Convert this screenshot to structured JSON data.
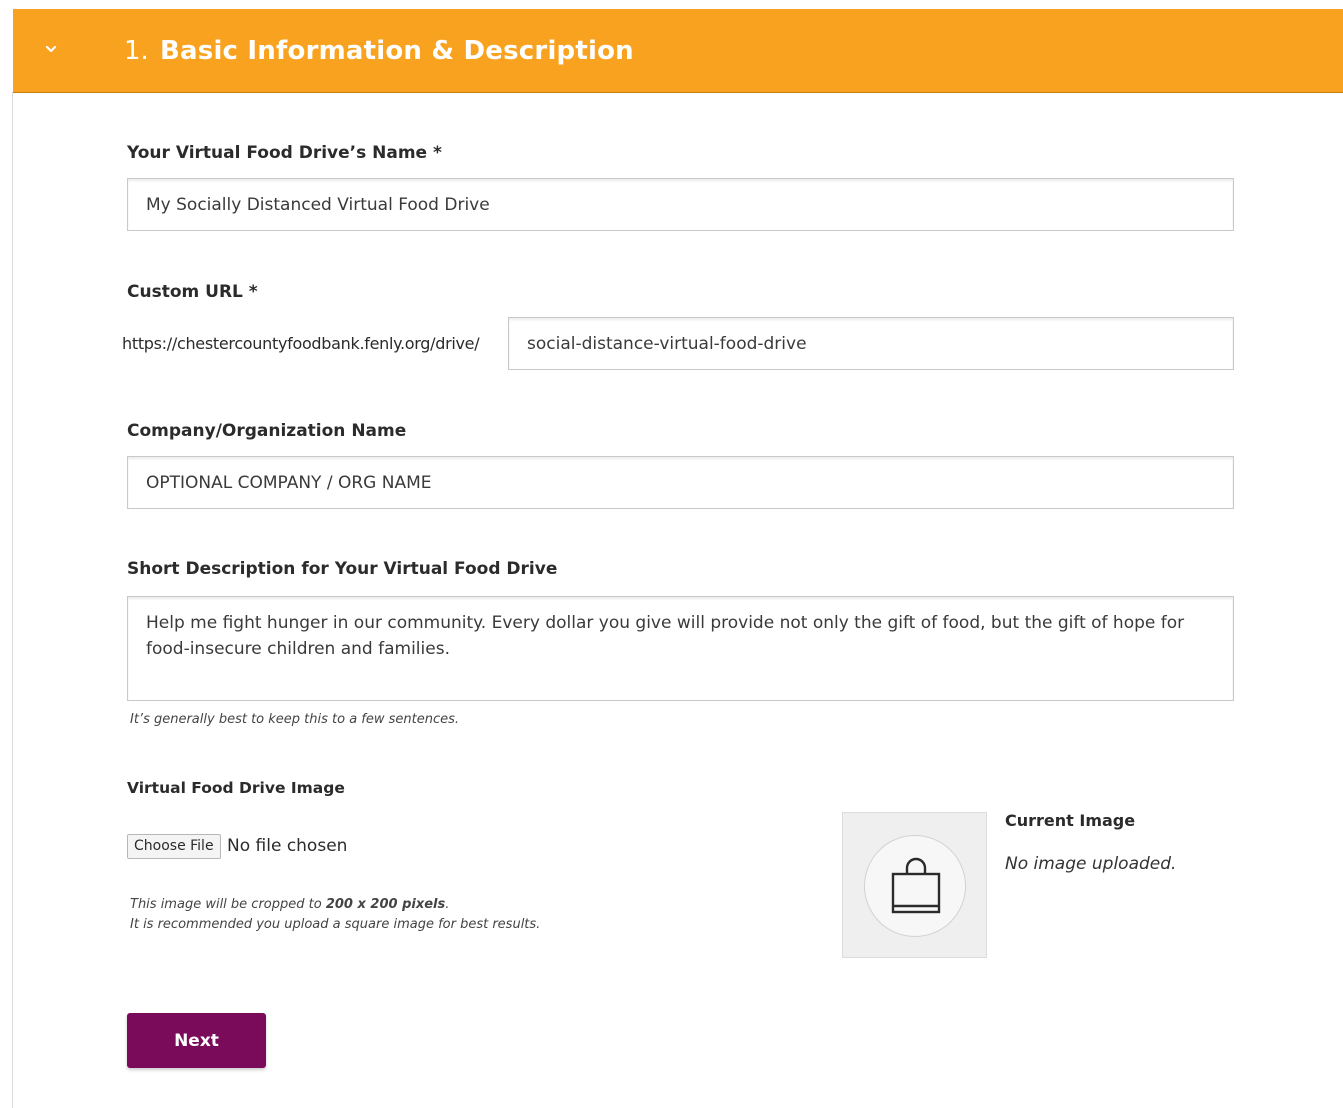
{
  "section": {
    "number": "1.",
    "title": "Basic Information & Description",
    "header_color": "#f9a21f",
    "toggle_icon": "chevron-down-icon"
  },
  "drive_name": {
    "label": "Your Virtual Food Drive’s Name *",
    "value": "My Socially Distanced Virtual Food Drive"
  },
  "custom_url": {
    "label": "Custom URL *",
    "prefix": "https://chestercountyfoodbank.fenly.org/drive/",
    "value": "social-distance-virtual-food-drive"
  },
  "company": {
    "label": "Company/Organization Name",
    "value": "OPTIONAL COMPANY / ORG NAME"
  },
  "description": {
    "label": "Short Description for Your Virtual Food Drive",
    "value": "Help me fight hunger in our community. Every dollar you give will provide not only the gift of food, but the gift of hope for food-insecure children and families.",
    "hint": "It’s generally best to keep this to a few sentences."
  },
  "image": {
    "label": "Virtual Food Drive Image",
    "choose_file_label": "Choose File",
    "file_status": "No file chosen",
    "hint_line1_prefix": "This image will be cropped to ",
    "hint_line1_bold": "200 x 200 pixels",
    "hint_line1_suffix": ".",
    "hint_line2": "It is recommended you upload a square image for best results.",
    "current_label": "Current Image",
    "current_status": "No image uploaded.",
    "placeholder_icon": "shopping-bag-icon"
  },
  "next_button": {
    "label": "Next",
    "color": "#7a0a5a"
  }
}
